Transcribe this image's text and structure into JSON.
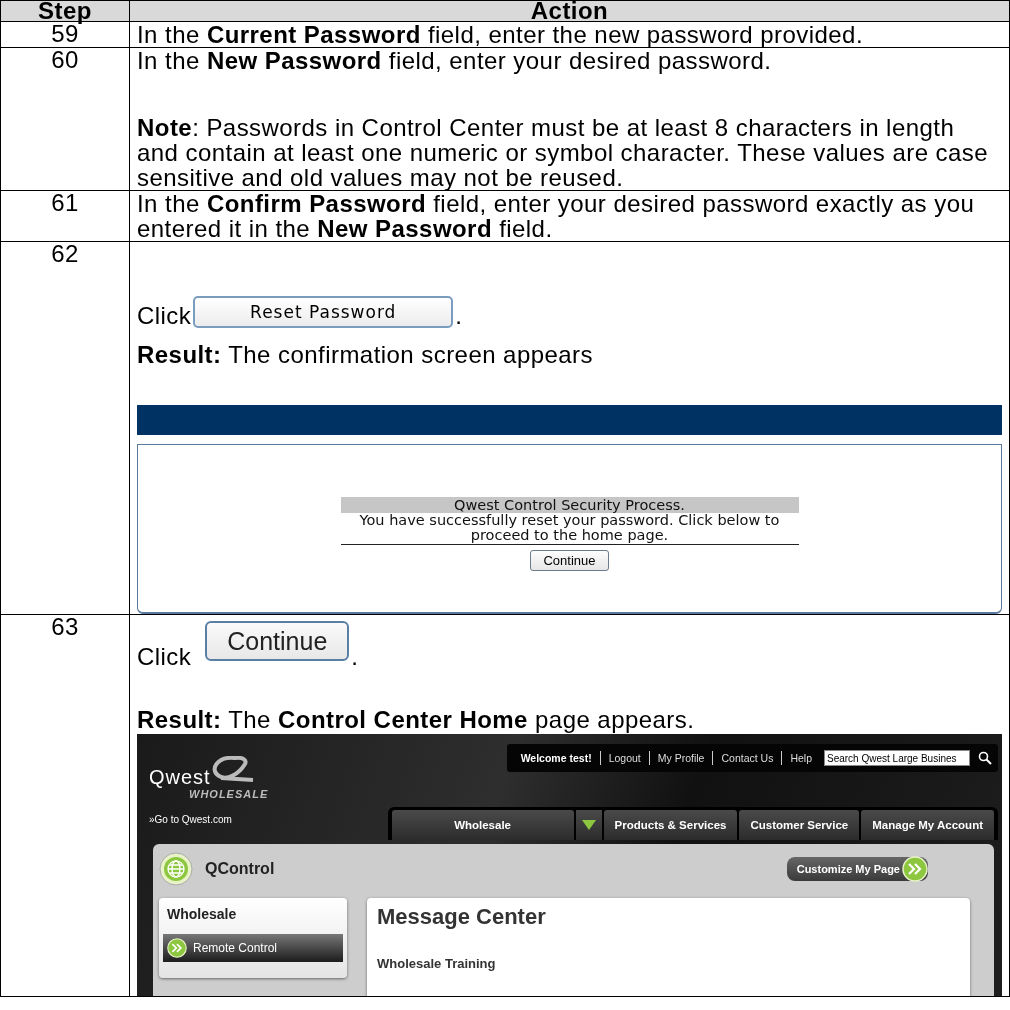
{
  "table": {
    "columns": [
      "Step",
      "Action"
    ],
    "rows": [
      {
        "step": "59",
        "blocks": [
          {
            "kind": "text",
            "text": "In the **Current Password** field, enter the new password provided."
          }
        ]
      },
      {
        "step": "60",
        "blocks": [
          {
            "kind": "text",
            "text": "In the **New Password** field, enter your desired password."
          },
          {
            "kind": "text",
            "text": "**Note**:  Passwords in Control Center must be at least 8 characters in length and contain at least one numeric or symbol character.  These values are case sensitive and old values may not be reused."
          }
        ]
      },
      {
        "step": "61",
        "blocks": [
          {
            "kind": "text",
            "text": "In the **Confirm Password** field, enter your desired password exactly as you entered it in the **New Password** field."
          }
        ]
      },
      {
        "step": "62",
        "blocks": [
          {
            "kind": "click-flat",
            "label": "Click",
            "button": "Reset Password",
            "suffix": "."
          },
          {
            "kind": "text",
            "text": "**Result:**  The confirmation screen appears"
          },
          {
            "kind": "confirm-screen",
            "heading": "Qwest Control Security Process.",
            "message": "You have successfully reset your password. Click below to proceed to the home page.",
            "button": "Continue"
          }
        ]
      },
      {
        "step": "63",
        "blocks": [
          {
            "kind": "click-raised",
            "label": "Click",
            "button": "Continue",
            "suffix": "."
          },
          {
            "kind": "text",
            "text": "**Result:**  The **Control Center Home** page appears."
          },
          {
            "kind": "home-screen",
            "logo": "Qwest",
            "logo_sub": "WHOLESALE",
            "go_link": "»Go to Qwest.com",
            "top_links": [
              {
                "kind": "greeting",
                "label": "Welcome test!"
              },
              {
                "kind": "link",
                "label": "Logout"
              },
              {
                "kind": "link",
                "label": "My Profile"
              },
              {
                "kind": "link",
                "label": "Contact Us"
              },
              {
                "kind": "link",
                "label": "Help"
              }
            ],
            "search_value": "Search Qwest Large Busines",
            "nav_tabs": [
              {
                "label": "Wholesale",
                "dropdown": true
              },
              {
                "label": "Products & Services",
                "dropdown": false
              },
              {
                "label": "Customer Service",
                "dropdown": false
              },
              {
                "label": "Manage My Account",
                "dropdown": false
              }
            ],
            "app_title": "QControl",
            "customize": "Customize My Page",
            "side_title": "Wholesale",
            "side_items": [
              "Remote Control"
            ],
            "main_title": "Message Center",
            "section": "Wholesale Training"
          }
        ]
      }
    ]
  }
}
